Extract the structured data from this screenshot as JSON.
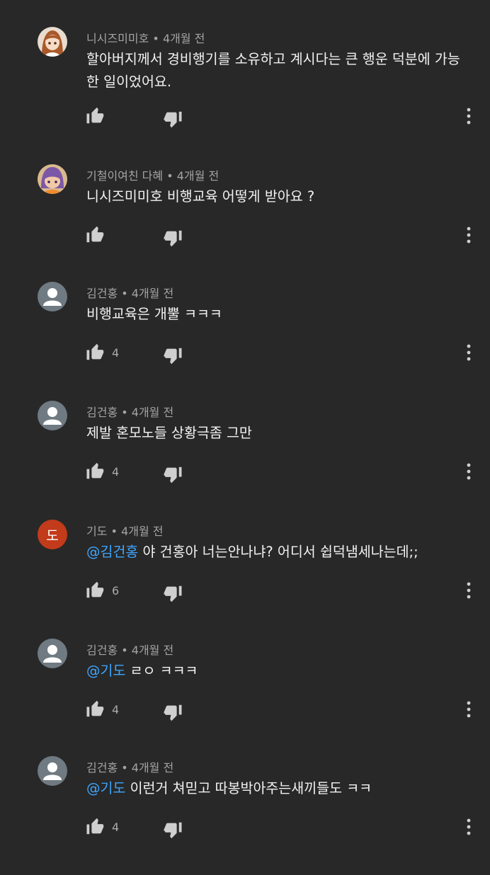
{
  "colors": {
    "background": "#282828",
    "text": "#f2f2f2",
    "meta": "#a4a4a4",
    "mention": "#3ea6ff",
    "avatar_letter_bg": "#c23b1a"
  },
  "icons": {
    "like": "thumbs-up-icon",
    "dislike": "thumbs-down-icon",
    "more": "more-vert-icon"
  },
  "comments": [
    {
      "author": "니시즈미미호",
      "time": "4개월 전",
      "mention": "",
      "text": "할아버지께서 경비행기를 소유하고 계시다는 큰 행운 덕분에 가능한 일이었어요.",
      "likes": "",
      "avatar": "anime"
    },
    {
      "author": "기철이여친 다혜",
      "time": "4개월 전",
      "mention": "",
      "text": "니시즈미미호 비행교육 어떻게 받아요 ?",
      "likes": "",
      "avatar": "anime"
    },
    {
      "author": "김건홍",
      "time": "4개월 전",
      "mention": "",
      "text": "비행교육은 개뿔 ㅋㅋㅋ",
      "likes": "4",
      "avatar": "default"
    },
    {
      "author": "김건홍",
      "time": "4개월 전",
      "mention": "",
      "text": "제발 혼모노들 상황극좀 그만",
      "likes": "4",
      "avatar": "default"
    },
    {
      "author": "기도",
      "time": "4개월 전",
      "mention": "@김건홍",
      "text": " 야 건홍아 너는안나냐? 어디서 쉽덕냄세나는데;;",
      "likes": "6",
      "avatar": "letter",
      "avatar_letter": "도"
    },
    {
      "author": "김건홍",
      "time": "4개월 전",
      "mention": "@기도",
      "text": " ㄹㅇ ㅋㅋㅋ",
      "likes": "4",
      "avatar": "default"
    },
    {
      "author": "김건홍",
      "time": "4개월 전",
      "mention": "@기도",
      "text": " 이런거 쳐믿고 따봉박아주는새끼들도 ㅋㅋ",
      "likes": "4",
      "avatar": "default"
    }
  ]
}
